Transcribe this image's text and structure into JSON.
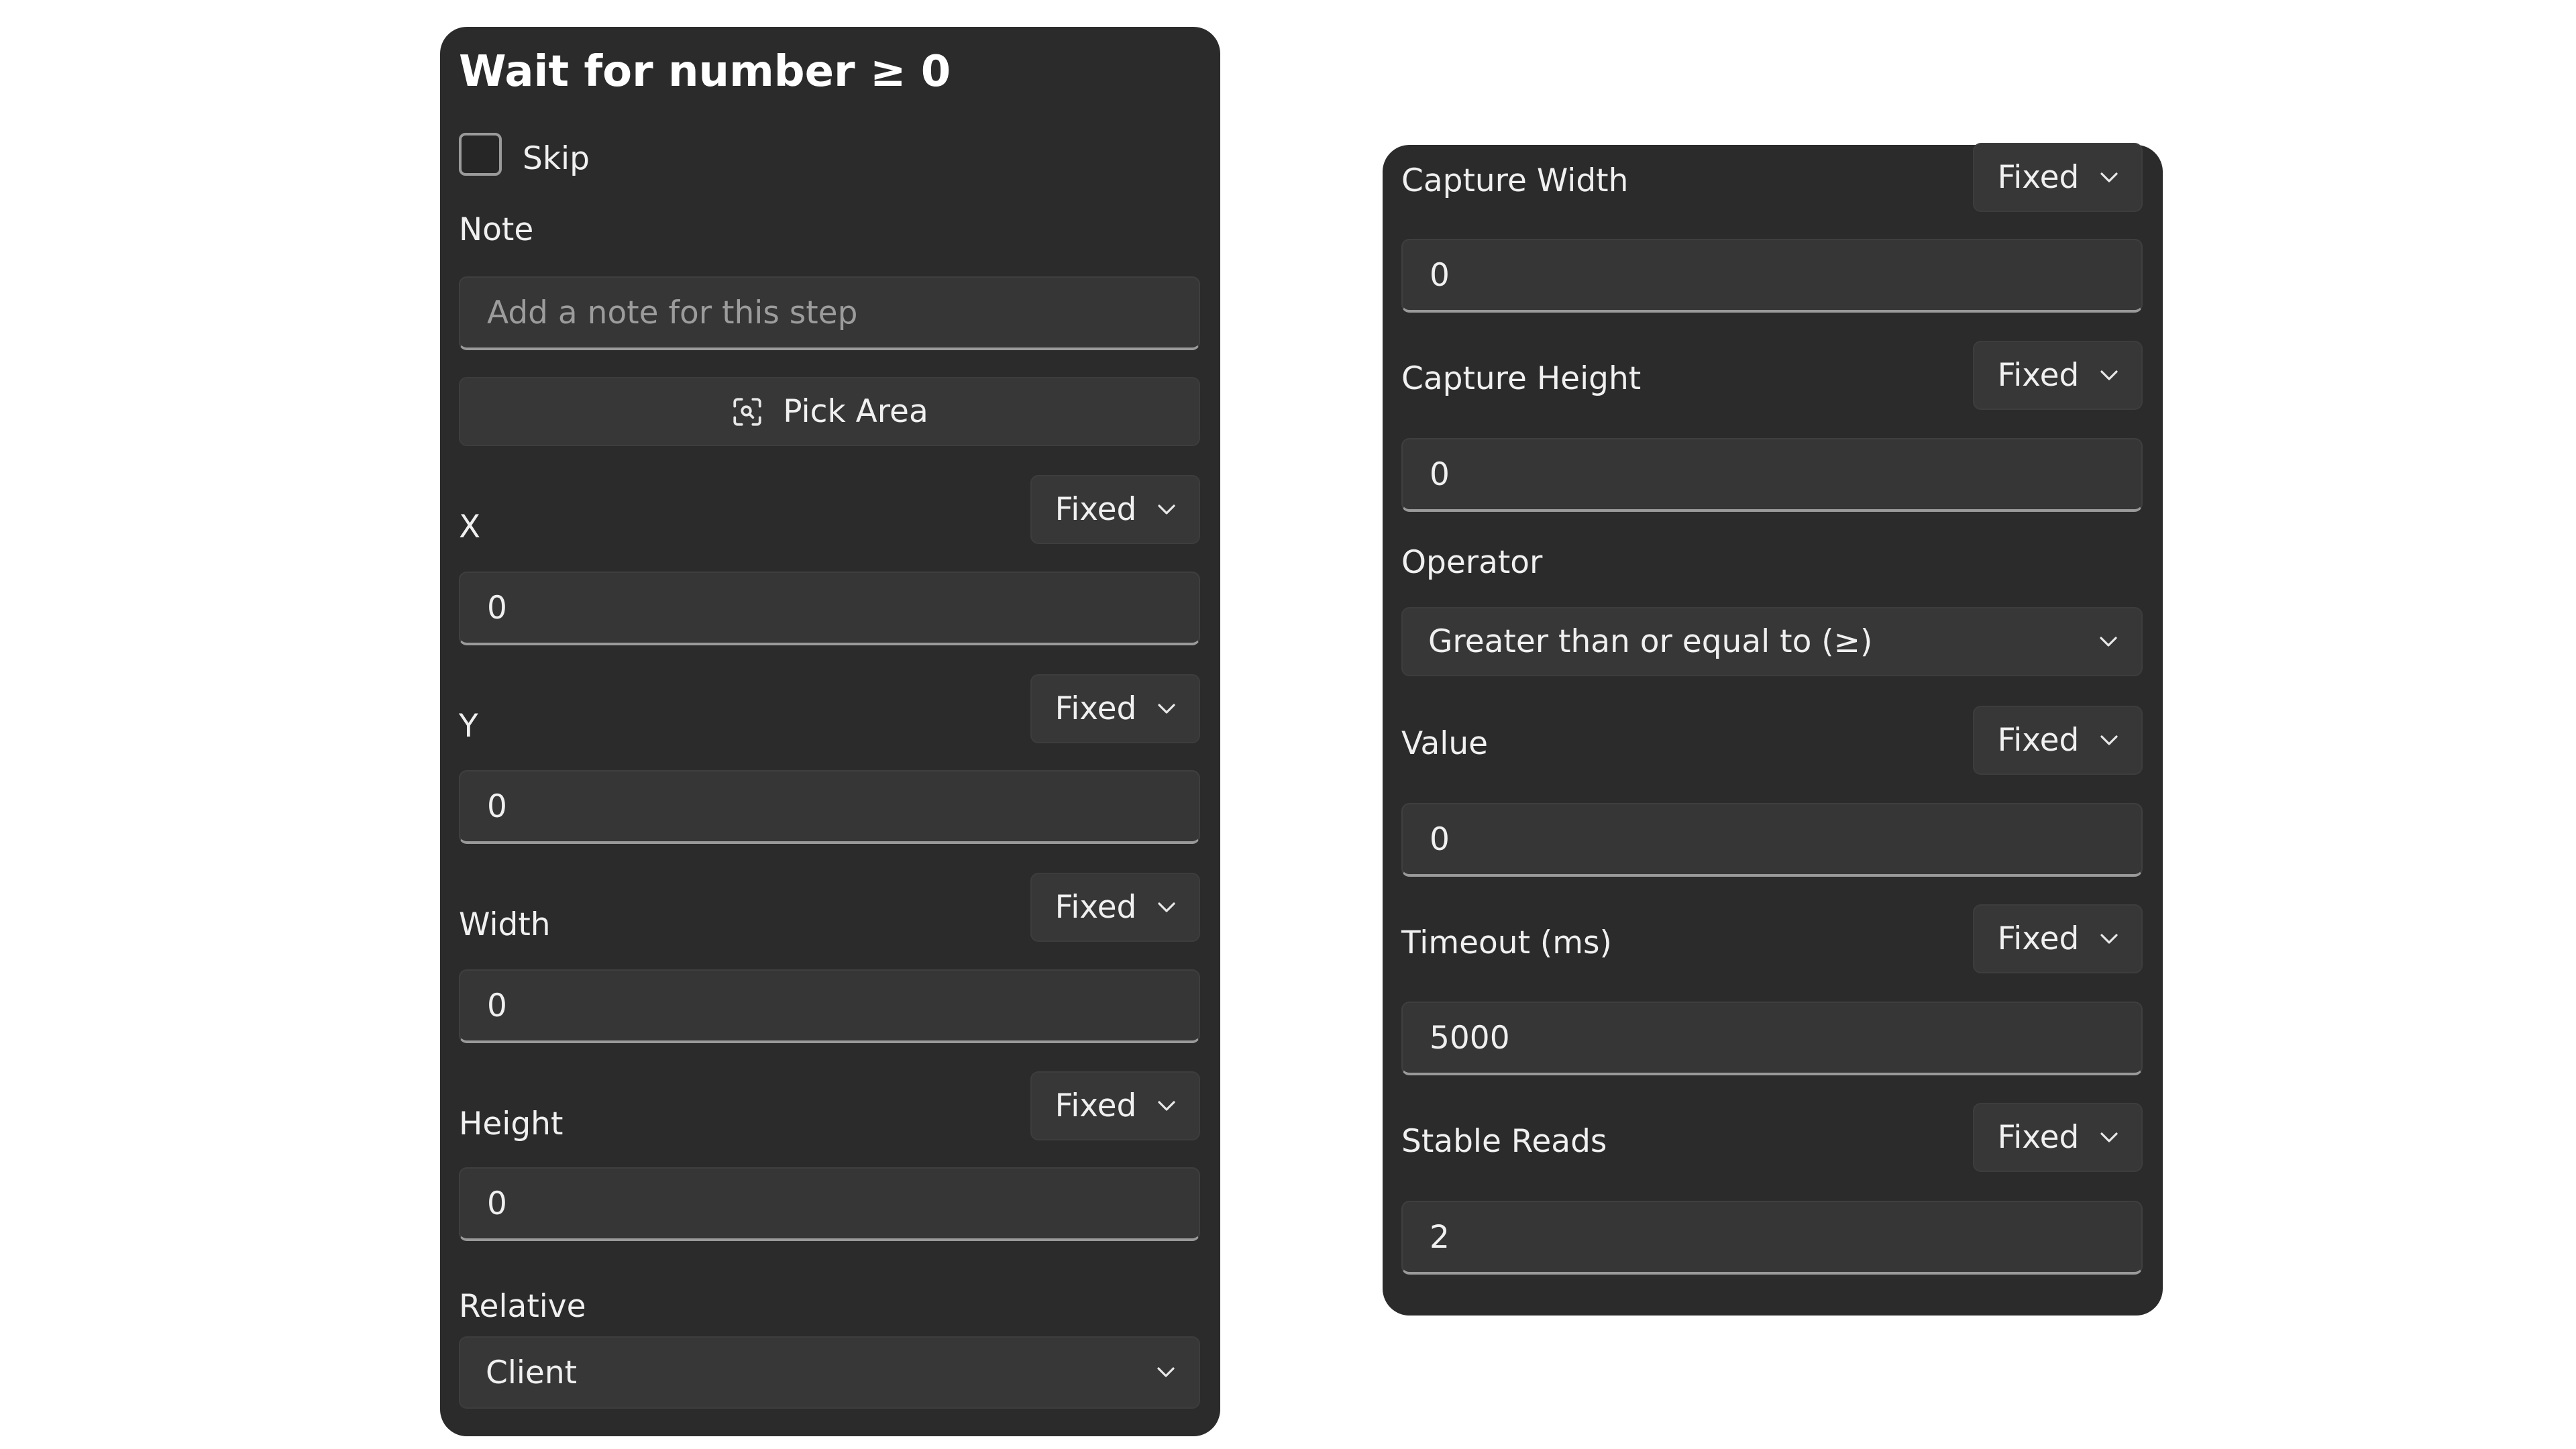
{
  "left_panel": {
    "title": "Wait for number ≥ 0",
    "skip_label": "Skip",
    "note_label": "Note",
    "note_placeholder": "Add a note for this step",
    "pick_area_label": "Pick Area",
    "x": {
      "label": "X",
      "mode": "Fixed",
      "value": "0"
    },
    "y": {
      "label": "Y",
      "mode": "Fixed",
      "value": "0"
    },
    "width": {
      "label": "Width",
      "mode": "Fixed",
      "value": "0"
    },
    "height": {
      "label": "Height",
      "mode": "Fixed",
      "value": "0"
    },
    "relative_label": "Relative",
    "relative_value": "Client"
  },
  "right_panel": {
    "capture_width": {
      "label": "Capture Width",
      "mode": "Fixed",
      "value": "0"
    },
    "capture_height": {
      "label": "Capture Height",
      "mode": "Fixed",
      "value": "0"
    },
    "operator_label": "Operator",
    "operator_value": "Greater than or equal to (≥)",
    "value": {
      "label": "Value",
      "mode": "Fixed",
      "value": "0"
    },
    "timeout": {
      "label": "Timeout (ms)",
      "mode": "Fixed",
      "value": "5000"
    },
    "stable_reads": {
      "label": "Stable Reads",
      "mode": "Fixed",
      "value": "2"
    }
  },
  "icons": {
    "pick_area": "focus-capture-icon",
    "dropdown": "chevron-down-icon"
  },
  "colors": {
    "panel_bg": "#2b2b2b",
    "field_bg": "#363636",
    "text": "#f0f0f0",
    "placeholder": "#9c9c9c"
  }
}
